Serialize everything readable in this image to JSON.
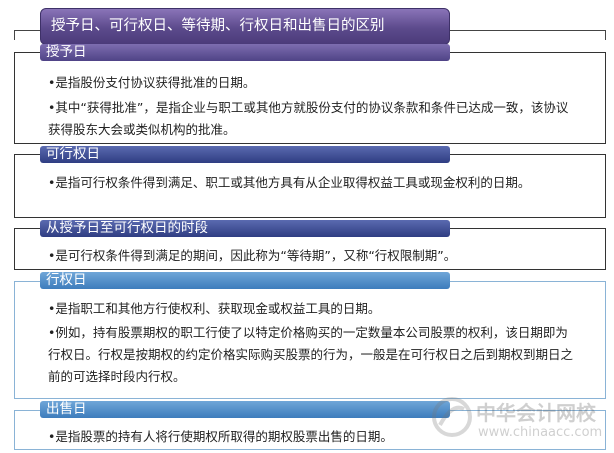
{
  "title": "授予日、可行权日、等待期、行权日和出售日的区别",
  "sections": [
    {
      "header": "授予日",
      "paragraphs": [
        "•是指股份支付协议获得批准的日期。",
        "•其中“获得批准”，是指企业与职工或其他方就股份支付的协议条款和条件已达成一致，该协议获得股东大会或类似机构的批准。"
      ]
    },
    {
      "header": "可行权日",
      "paragraphs": [
        "•是指可行权条件得到满足、职工或其他方具有从企业取得权益工具或现金权利的日期。"
      ]
    },
    {
      "header": "从授予日至可行权日的时段",
      "paragraphs": [
        "•是可行权条件得到满足的期间，因此称为“等待期”，又称“行权限制期”。"
      ]
    },
    {
      "header": "行权日",
      "paragraphs": [
        "•是指职工和其他方行使权利、获取现金或权益工具的日期。",
        "•例如，持有股票期权的职工行使了以特定价格购买的一定数量本公司股票的权利，该日期即为行权日。行权是按期权的约定价格实际购买股票的行为，一般是在可行权日之后到期权到期日之前的可选择时段内行权。"
      ]
    },
    {
      "header": "出售日",
      "paragraphs": [
        "•是指股票的持有人将行使期权所取得的期权股票出售的日期。"
      ]
    }
  ],
  "watermark": {
    "name": "中华会计网校",
    "url": "www.chinaacc.com"
  },
  "colors": {
    "title_bg": "#5c4a8c",
    "header_purple": "#4f4386",
    "header_navy": "#2f3d82",
    "header_blue": "#3d7cbc"
  }
}
